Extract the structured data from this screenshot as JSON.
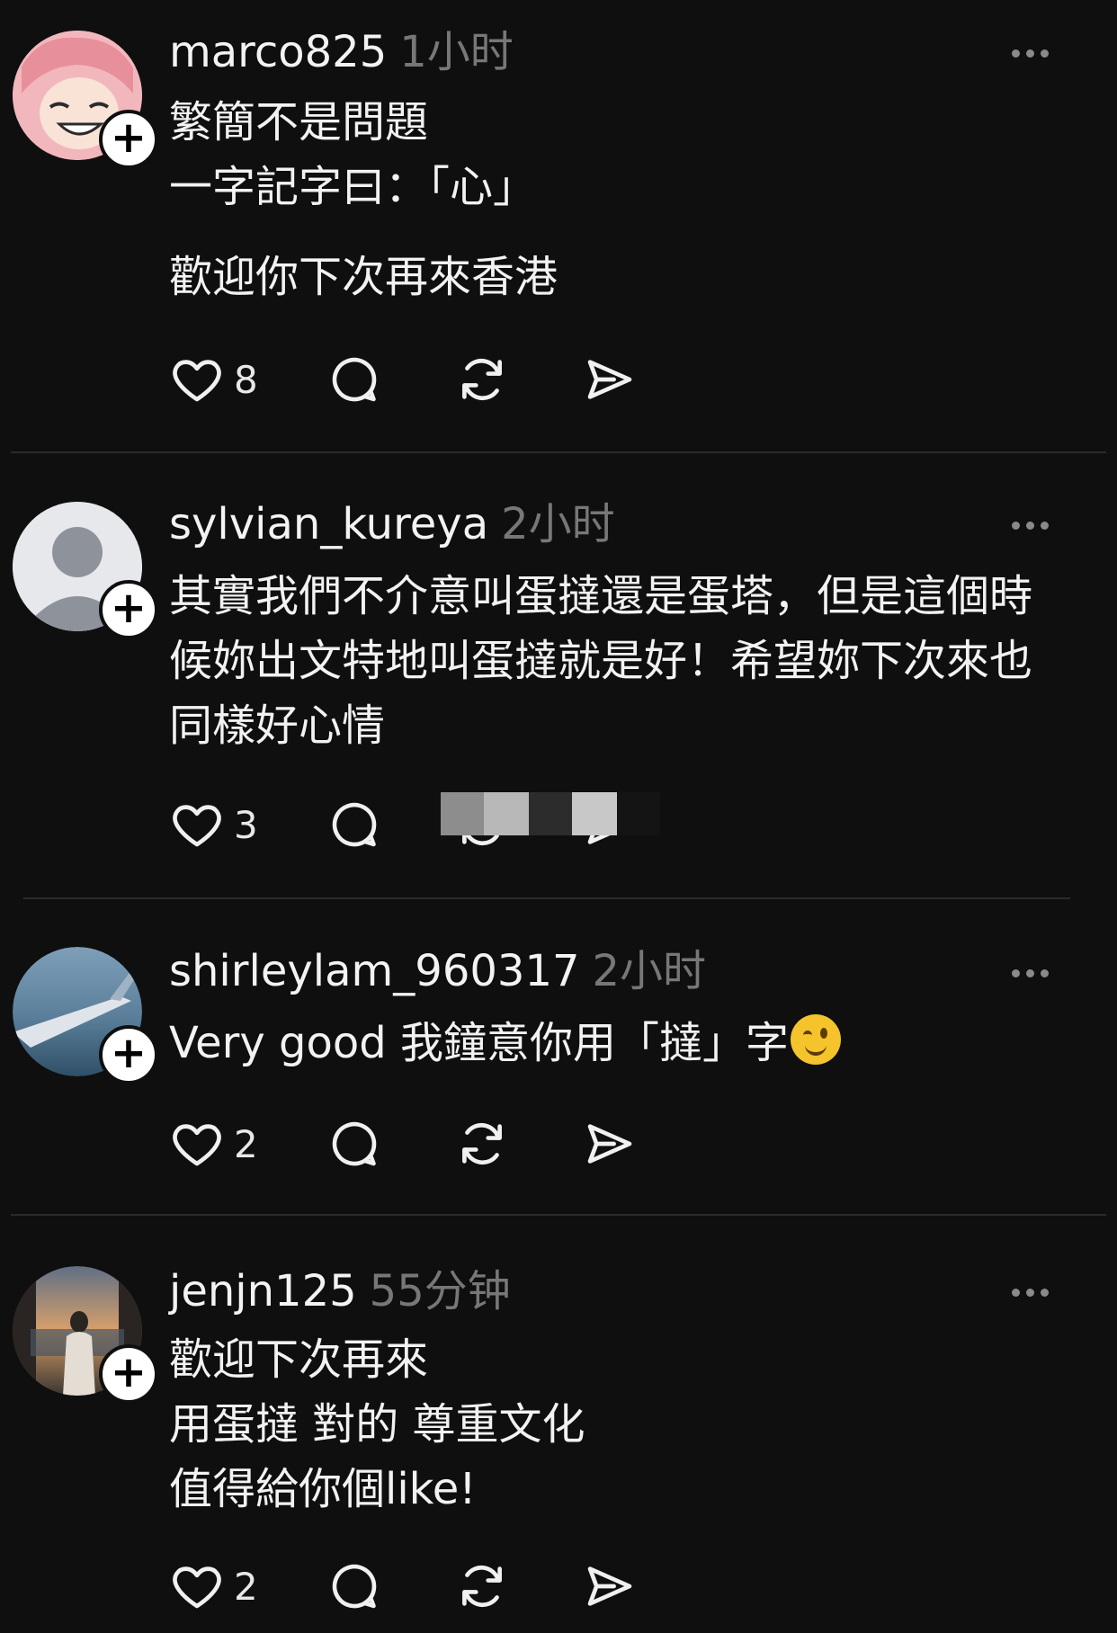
{
  "comments": [
    {
      "username": "marco825",
      "time": "1小时",
      "lines": [
        "繁簡不是問題",
        "一字記字曰：「心」",
        "",
        "歡迎你下次再來香港"
      ],
      "likes": "8",
      "avatar": "pink-hair-anime-avatar"
    },
    {
      "username": "sylvian_kureya",
      "time": "2小时",
      "lines": [
        "其實我們不介意叫蛋撻還是蛋塔，但是這個時",
        "候妳出文特地叫蛋撻就是好！希望妳下次來也",
        "同樣好心情"
      ],
      "likes": "3",
      "avatar": "default-gray-avatar"
    },
    {
      "username": "shirleylam_960317",
      "time": "2小时",
      "text": "Very good 我鐘意你用「撻」字",
      "emoji": "winking-face-emoji",
      "likes": "2",
      "avatar": "airplane-wing-sky-avatar"
    },
    {
      "username": "jenjn125",
      "time": "55分钟",
      "lines": [
        "歡迎下次再來",
        "用蛋撻 對的 尊重文化",
        "值得給你個like!"
      ],
      "likes": "2",
      "avatar": "person-window-sunset-avatar"
    }
  ],
  "icons": {
    "like": "heart-icon",
    "reply": "speech-bubble-icon",
    "repost": "repost-icon",
    "share": "send-icon",
    "more": "more-dots-icon",
    "follow": "plus-icon"
  }
}
